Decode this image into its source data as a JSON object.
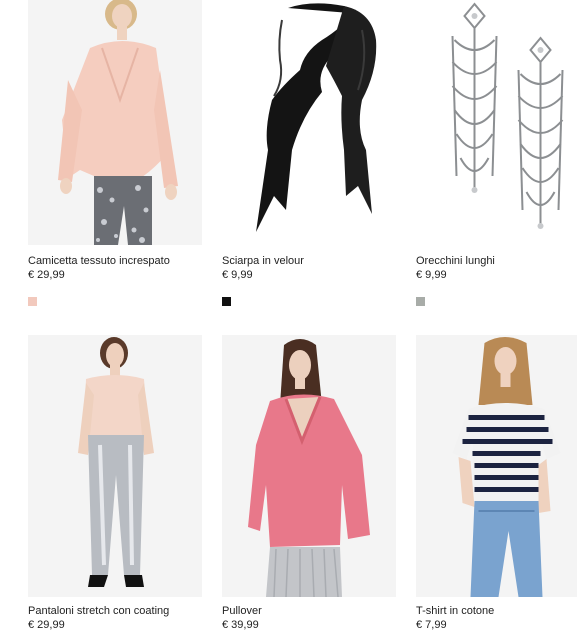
{
  "products": [
    {
      "name": "Camicetta tessuto increspato",
      "price": "€ 29,99",
      "image": "woman-pink-blouse-sequin-trousers",
      "swatch": "#f2c9bd"
    },
    {
      "name": "Sciarpa in velour",
      "price": "€ 9,99",
      "image": "black-velour-skinny-scarf",
      "swatch": "#111111"
    },
    {
      "name": "Orecchini lunghi",
      "price": "€ 9,99",
      "image": "silver-rhinestone-drop-earrings",
      "swatch": "#a8aca8"
    },
    {
      "name": "Pantaloni stretch con coating",
      "price": "€ 29,99",
      "image": "woman-silver-coated-trousers"
    },
    {
      "name": "Pullover",
      "price": "€ 39,99",
      "image": "woman-pink-v-neck-pullover"
    },
    {
      "name": "T-shirt in cotone",
      "price": "€ 7,99",
      "image": "woman-striped-t-shirt-jeans"
    }
  ]
}
